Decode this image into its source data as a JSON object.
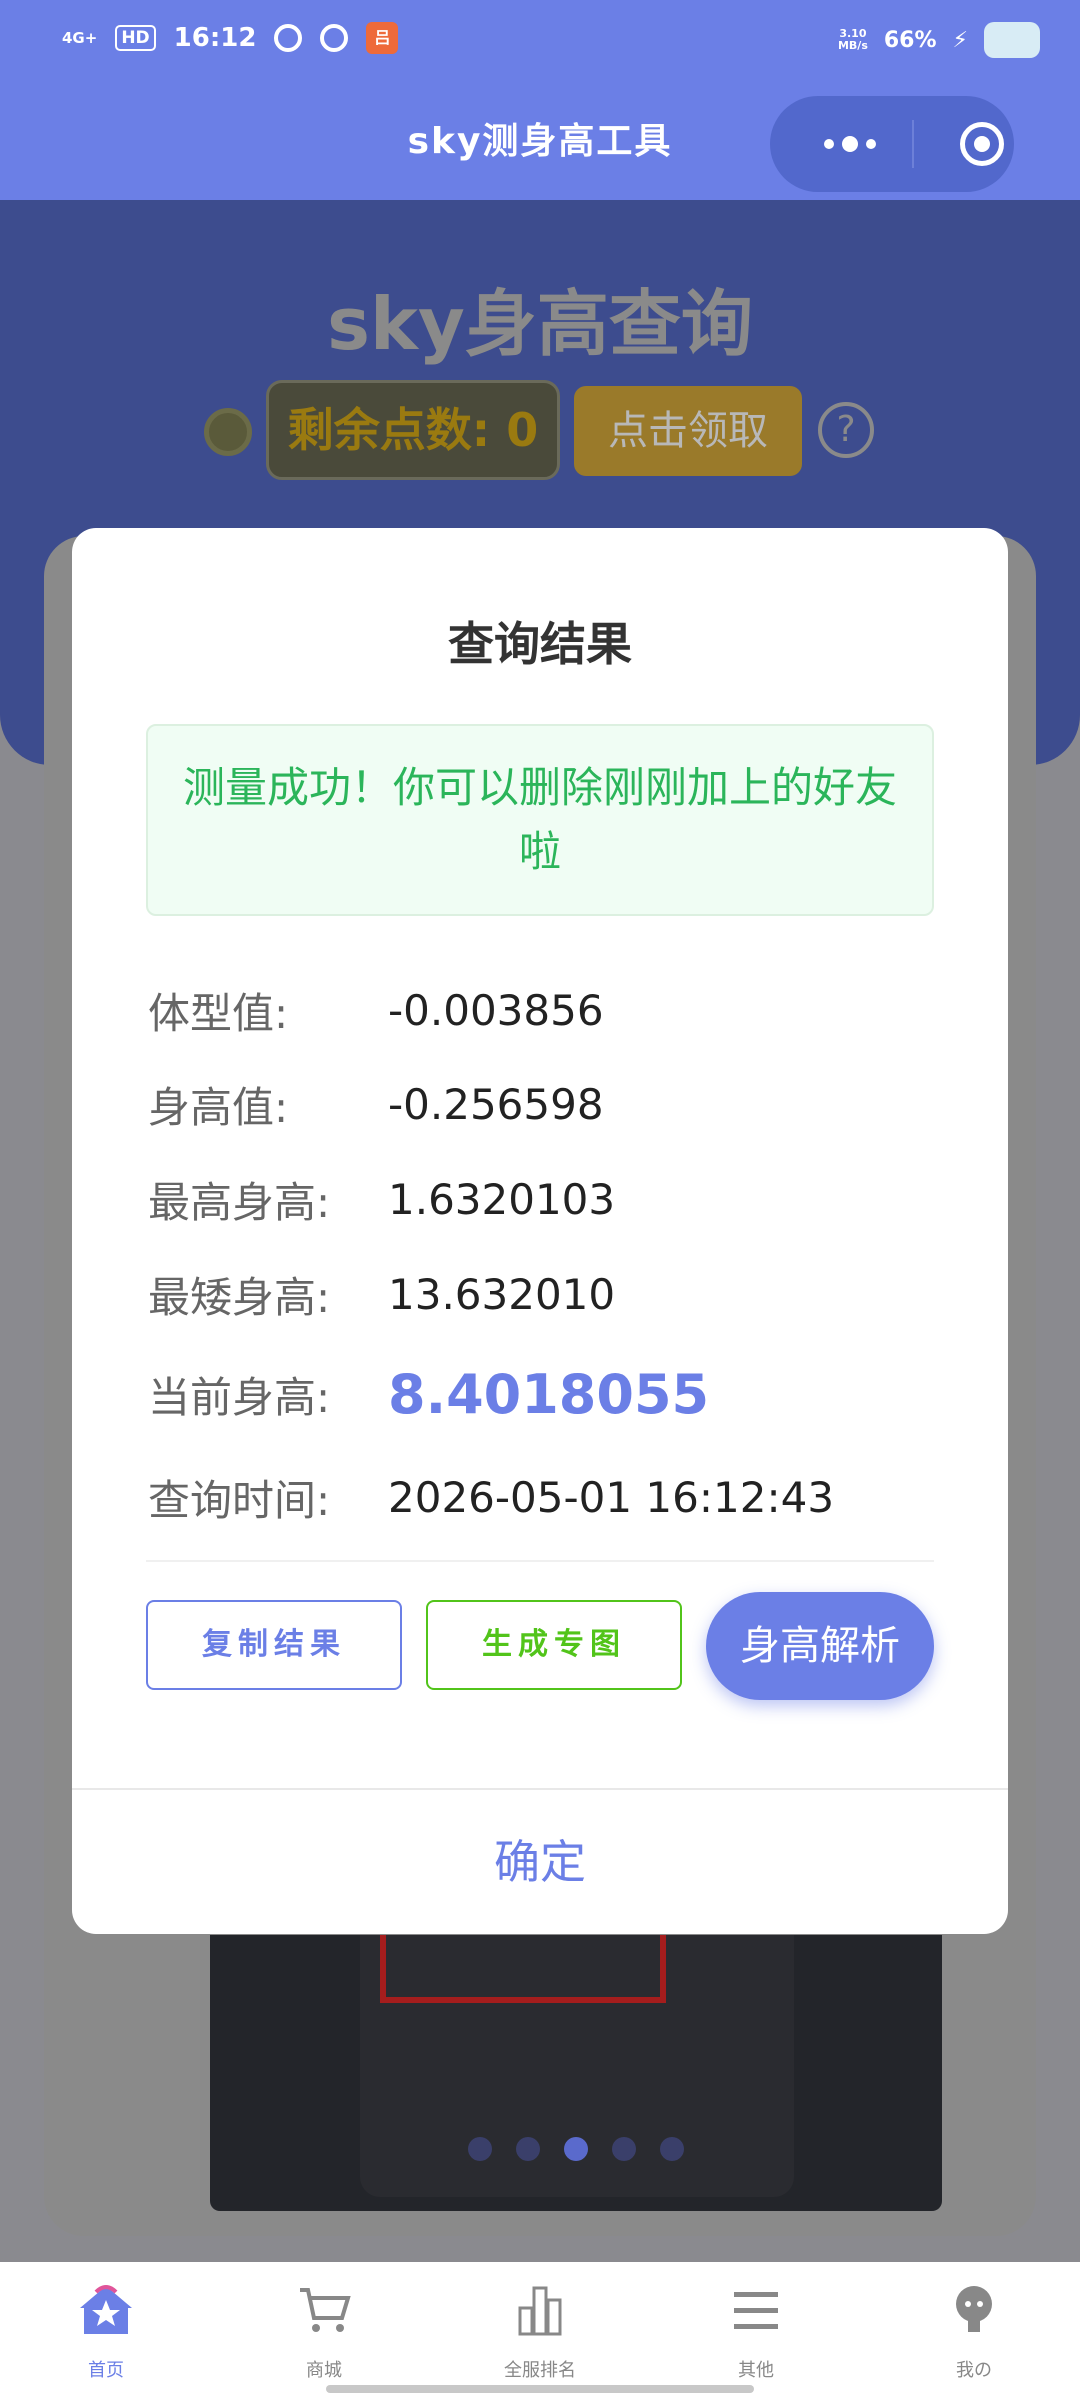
{
  "status_bar": {
    "network": "4G+",
    "hd": "HD",
    "time": "16:12",
    "app_badge": "吕",
    "speed": "3.10\nMB/s",
    "battery": "66%"
  },
  "navbar": {
    "title": "sky测身高工具"
  },
  "background": {
    "hero_title": "sky身高查询",
    "points_label": "剩余点数: 0",
    "claim_button": "点击领取",
    "help_icon": "?"
  },
  "modal": {
    "title": "查询结果",
    "success_message": "测量成功！你可以删除刚刚加上的好友啦",
    "rows": [
      {
        "label": "体型值:",
        "value": "-0.003856"
      },
      {
        "label": "身高值:",
        "value": "-0.256598"
      },
      {
        "label": "最高身高:",
        "value": "1.6320103"
      },
      {
        "label": "最矮身高:",
        "value": "13.632010"
      },
      {
        "label": "当前身高:",
        "value": "8.4018055"
      },
      {
        "label": "查询时间:",
        "value": "2026-05-01 16:12:43"
      }
    ],
    "copy_button": "复制结果",
    "generate_button": "生成专图",
    "analyze_button": "身高解析",
    "confirm_button": "确定"
  },
  "tabbar": {
    "items": [
      {
        "label": "首页",
        "icon": "home-star-icon",
        "active": true
      },
      {
        "label": "商城",
        "icon": "cart-icon",
        "active": false
      },
      {
        "label": "全服排名",
        "icon": "bar-chart-icon",
        "active": false
      },
      {
        "label": "其他",
        "icon": "menu-icon",
        "active": false
      },
      {
        "label": "我の",
        "icon": "user-icon",
        "active": false
      }
    ]
  },
  "colors": {
    "primary": "#6b7fe6",
    "success": "#2bb55a",
    "gold": "#e6a23c"
  }
}
